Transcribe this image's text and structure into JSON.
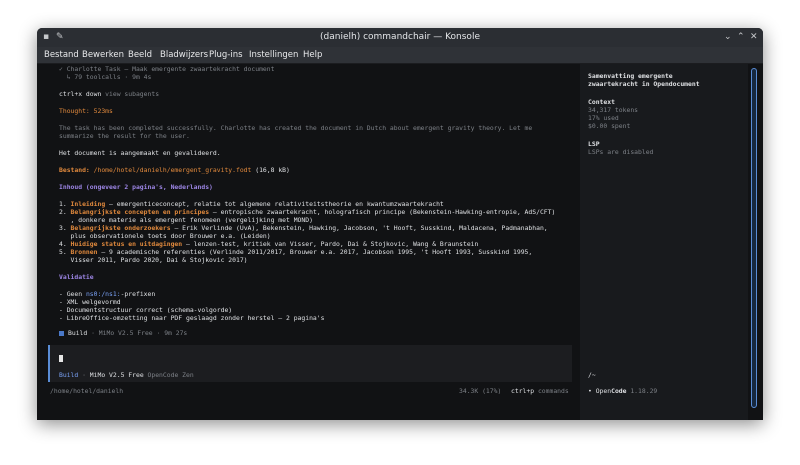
{
  "window": {
    "title": "(danielh) commandchair — Konsole"
  },
  "menu": [
    "Bestand",
    "Bewerken",
    "Beeld",
    "Bladwijzers",
    "Plug-ins",
    "Instellingen",
    "Help"
  ],
  "task": {
    "line1": "✓ Charlotte Task — Maak emergente zwaartekracht document",
    "line2": "  ↳ 79 toolcalls · 9m 4s"
  },
  "hint": {
    "key": "ctrl+x down",
    "label": " view subagents"
  },
  "thought": "Thought: 523ms",
  "summary": [
    "The task has been completed successfully. Charlotte has created the document in Dutch about emergent gravity theory. Let me",
    "summarize the result for the user."
  ],
  "created": "Het document is aangemaakt en gevalideerd.",
  "file": {
    "label": "Bestand:",
    "path": " /home/hotel/danielh/emergent_gravity.fodt",
    "size": " (16,8 kB)"
  },
  "contents_heading": "Inhoud (ongeveer 2 pagina's, Nederlands)",
  "contents": [
    {
      "num": "1. ",
      "title": "Inleiding",
      "rest": " — emergenticeconcept, relatie tot algemene relativiteitstheorie en kwantumzwaartekracht"
    },
    {
      "num": "2. ",
      "title": "Belangrijkste concepten en principes",
      "rest": " — entropische zwaartekracht, holografisch principe (Bekenstein-Hawking-entropie, AdS/CFT)",
      "cont": "   , donkere materie als emergent fenomeen (vergelijking met MOND)"
    },
    {
      "num": "3. ",
      "title": "Belangrijkste onderzoekers",
      "rest": " — Erik Verlinde (UvA), Bekenstein, Hawking, Jacobson, 't Hooft, Susskind, Maldacena, Padmanabhan,",
      "cont": "   plus observationele toets door Brouwer e.a. (Leiden)"
    },
    {
      "num": "4. ",
      "title": "Huidige status en uitdagingen",
      "rest": " — lenzen-test, kritiek van Visser, Pardo, Dai & Stojkovic, Wang & Braunstein"
    },
    {
      "num": "5. ",
      "title": "Bronnen",
      "rest": " — 9 academische referenties (Verlinde 2011/2017, Brouwer e.a. 2017, Jacobson 1995, 't Hooft 1993, Susskind 1995,",
      "cont": "   Visser 2011, Pardo 2020, Dai & Stojkovic 2017)"
    }
  ],
  "validation_heading": "Validatie",
  "validation": [
    {
      "pre": "- Geen ",
      "code": "ns0:/ns1:",
      "post": "-prefixen"
    },
    {
      "pre": "- XML welgevormd",
      "code": "",
      "post": ""
    },
    {
      "pre": "- Documentstructuur correct (schema-volgorde)",
      "code": "",
      "post": ""
    },
    {
      "pre": "- LibreOffice-omzetting naar PDF geslaagd zonder herstel — 2 pagina's",
      "code": "",
      "post": ""
    }
  ],
  "build_status": {
    "mode": "Build",
    "info": " · MiMo V2.5 Free · 9m 27s"
  },
  "prompt": {
    "mode": "Build",
    "sep": " · ",
    "model": "MiMo V2.5 Free",
    "provider": " OpenCode Zen"
  },
  "statusbar": {
    "cwd": "/home/hotel/danielh",
    "usage": "34.3K (17%)",
    "key": "ctrl+p",
    "label": " commands"
  },
  "sidebar": {
    "title_line1": "Samenvatting emergente",
    "title_line2": "zwaartekracht in Opendocument",
    "context_heading": "Context",
    "tokens": "34,317 tokens",
    "used": "17% used",
    "spent": "$0.00 spent",
    "lsp_heading": "LSP",
    "lsp_status": "LSPs are disabled",
    "cwd": "/~",
    "app_prefix": "• Open",
    "app_name": "Code",
    "version": " 1.18.29"
  },
  "colors": {
    "accent": "#5a8dd6",
    "orange": "#e28a3d",
    "purple": "#9d86e6"
  }
}
